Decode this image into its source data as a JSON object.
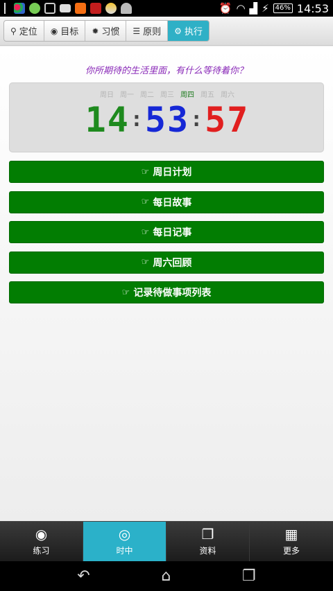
{
  "status_bar": {
    "time": "14:53",
    "battery": "46%",
    "notification_icons": [
      "usb-icon",
      "app-icon",
      "chat-icon",
      "image-icon",
      "mail-icon",
      "taobao-icon",
      "festival-icon",
      "weather-icon",
      "android-icon"
    ]
  },
  "tabs": [
    {
      "label": "定位",
      "icon": "map-marker-icon",
      "glyph": "⚲"
    },
    {
      "label": "目标",
      "icon": "target-icon",
      "glyph": "◉"
    },
    {
      "label": "习惯",
      "icon": "gear-icon",
      "glyph": "✹"
    },
    {
      "label": "原则",
      "icon": "list-icon",
      "glyph": "☰"
    },
    {
      "label": "执行",
      "icon": "cogs-icon",
      "glyph": "⚙"
    }
  ],
  "prompt": "你所期待的生活里面，有什么等待着你？",
  "clock": {
    "weekdays": [
      "周日",
      "周一",
      "周二",
      "周三",
      "周四",
      "周五",
      "周六"
    ],
    "today_index": 4,
    "hours": "14",
    "minutes": "53",
    "seconds": "57",
    "colors": {
      "hours": "#1e8a1e",
      "minutes": "#1628d6",
      "seconds": "#e11f1f"
    }
  },
  "actions": [
    {
      "label": "周日计划"
    },
    {
      "label": "每日故事"
    },
    {
      "label": "每日记事"
    },
    {
      "label": "周六回顾"
    },
    {
      "label": "记录待做事项列表"
    }
  ],
  "bottom_nav": [
    {
      "label": "练习",
      "icon": "eye-icon",
      "glyph": "◉"
    },
    {
      "label": "时中",
      "icon": "target-circle-icon",
      "glyph": "◎"
    },
    {
      "label": "资料",
      "icon": "files-icon",
      "glyph": "❐"
    },
    {
      "label": "更多",
      "icon": "grid-icon",
      "glyph": "▦"
    }
  ],
  "colors": {
    "accent": "#2fb0c6",
    "action_green": "#027d02",
    "prompt_purple": "#8a2ab8"
  }
}
